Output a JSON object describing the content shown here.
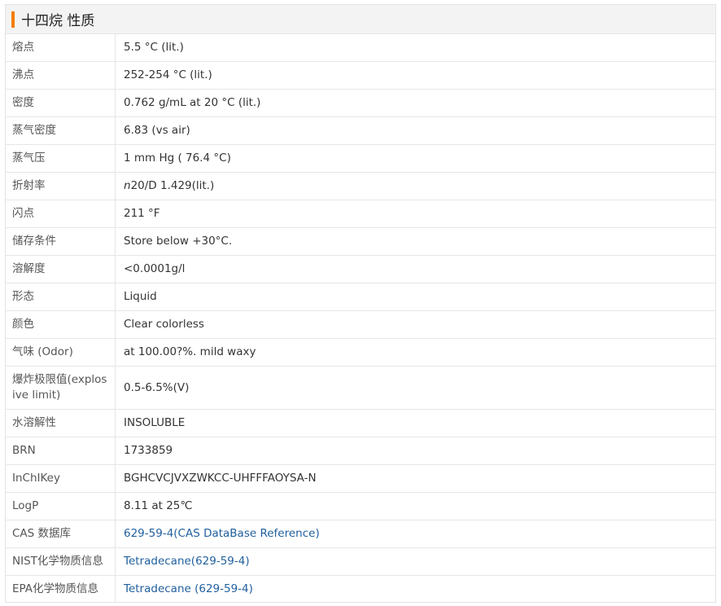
{
  "header": {
    "title": "十四烷 性质",
    "accent_color": "#f47c00"
  },
  "rows": [
    {
      "key": "熔点",
      "value": "5.5 °C (lit.)"
    },
    {
      "key": "沸点",
      "value": "252-254 °C (lit.)"
    },
    {
      "key": "密度",
      "value": "0.762 g/mL at 20 °C (lit.)"
    },
    {
      "key": "蒸气密度",
      "value": "6.83 (vs air)"
    },
    {
      "key": "蒸气压",
      "value": "1 mm Hg ( 76.4 °C)"
    },
    {
      "key": "折射率",
      "value_prefix_italic": "n",
      "value": "20/D 1.429(lit.)"
    },
    {
      "key": "闪点",
      "value": "211 °F"
    },
    {
      "key": "储存条件",
      "value": "Store below +30°C."
    },
    {
      "key": "溶解度",
      "value": "<0.0001g/l"
    },
    {
      "key": "形态",
      "value": "Liquid"
    },
    {
      "key": "颜色",
      "value": "Clear colorless"
    },
    {
      "key": "气味 (Odor)",
      "value": "at 100.00?%. mild waxy"
    },
    {
      "key": "爆炸极限值(explosive limit)",
      "value": "0.5-6.5%(V)"
    },
    {
      "key": "水溶解性",
      "value": "INSOLUBLE"
    },
    {
      "key": "BRN",
      "value": "1733859"
    },
    {
      "key": "InChIKey",
      "value": "BGHCVCJVXZWKCC-UHFFFAOYSA-N"
    },
    {
      "key": "LogP",
      "value": "8.11 at 25℃"
    },
    {
      "key": "CAS 数据库",
      "value": "629-59-4(CAS DataBase Reference)"
    },
    {
      "key": "NIST化学物质信息",
      "value": "Tetradecane(629-59-4)"
    },
    {
      "key": "EPA化学物质信息",
      "value": "Tetradecane (629-59-4)"
    }
  ],
  "link_color": "#1f5f9e"
}
